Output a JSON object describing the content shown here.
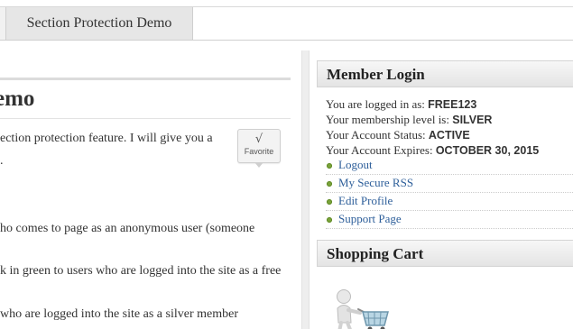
{
  "nav": {
    "tab_label": "Section Protection Demo"
  },
  "content": {
    "title": "emo",
    "paragraph1_line1": "ection protection feature. I will give you a",
    "paragraph1_line2": ".",
    "line_anonymous": "ho comes to page as an anonymous user (someone",
    "line_free": "k in green to users who are logged into the site as a free",
    "line_silver": " who are logged into the site as a silver member",
    "favorite": {
      "check": "√",
      "label": "Favorite"
    }
  },
  "sidebar": {
    "login_widget": {
      "title": "Member Login",
      "logged_in_label": "You are logged in as:",
      "logged_in_value": "FREE123",
      "level_label": "Your membership level is:",
      "level_value": "SILVER",
      "status_label": "Your Account Status:",
      "status_value": "ACTIVE",
      "expires_label": "Your Account Expires:",
      "expires_value": "OCTOBER 30, 2015",
      "links": [
        "Logout",
        "My Secure RSS",
        "Edit Profile",
        "Support Page"
      ]
    },
    "cart_widget": {
      "title": "Shopping Cart"
    }
  },
  "colors": {
    "link": "#2e5f9a",
    "bullet": "#7aa33a",
    "widget_header": "#e4e4e4"
  },
  "icons": {
    "favorite": "checkmark-icon",
    "bullet": "green-bullet-icon",
    "cart": "shopping-cart-figure-icon"
  }
}
